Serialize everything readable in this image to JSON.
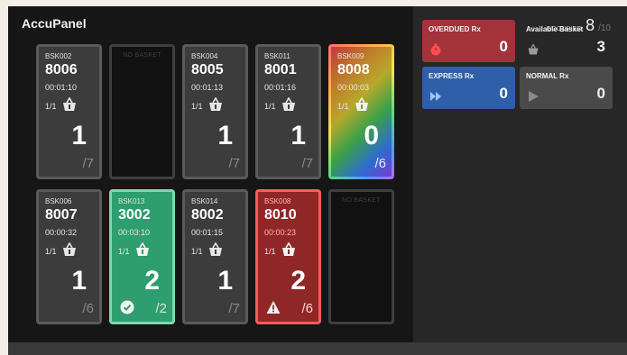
{
  "app": {
    "title": "AccuPanel"
  },
  "occupied": {
    "label": "OCCUPIED",
    "count": "8",
    "total": "/10"
  },
  "cards": [
    {
      "id": "BSK002",
      "code": "8006",
      "time": "00:01:10",
      "frac": "1/1",
      "count": "1",
      "capacity": "/7",
      "state": "normal"
    },
    {
      "empty_label": "NO BASKET",
      "state": "empty"
    },
    {
      "id": "BSK004",
      "code": "8005",
      "time": "00:01:13",
      "frac": "1/1",
      "count": "1",
      "capacity": "/7",
      "state": "normal"
    },
    {
      "id": "BSK011",
      "code": "8001",
      "time": "00:01:16",
      "frac": "1/1",
      "count": "1",
      "capacity": "/7",
      "state": "normal"
    },
    {
      "id": "BSK009",
      "code": "8008",
      "time": "00:00:03",
      "frac": "1/1",
      "count": "0",
      "capacity": "/6",
      "state": "rainbow"
    },
    {
      "id": "BSK006",
      "code": "8007",
      "time": "00:00:32",
      "frac": "1/1",
      "count": "1",
      "capacity": "/6",
      "state": "normal"
    },
    {
      "id": "BSK013",
      "code": "3002",
      "time": "00:03:10",
      "frac": "1/1",
      "count": "2",
      "capacity": "/2",
      "state": "complete"
    },
    {
      "id": "BSK014",
      "code": "8002",
      "time": "00:01:15",
      "frac": "1/1",
      "count": "1",
      "capacity": "/7",
      "state": "normal"
    },
    {
      "id": "BSK008",
      "code": "8010",
      "time": "00:00:23",
      "frac": "1/1",
      "count": "2",
      "capacity": "/6",
      "state": "alert"
    },
    {
      "empty_label": "NO BASKET",
      "state": "empty"
    }
  ],
  "stats": {
    "overdue": {
      "title": "OVERDUED Rx",
      "value": "0",
      "icon": "timer-icon"
    },
    "available": {
      "title": "Available Basket",
      "value": "3",
      "icon": "basket-icon"
    },
    "express": {
      "title": "EXPRESS Rx",
      "value": "0",
      "icon": "fast-forward-icon"
    },
    "normal": {
      "title": "NORMAL Rx",
      "value": "0",
      "icon": "play-icon"
    }
  },
  "colors": {
    "overdue": "#a4323a",
    "express": "#2f5fa8",
    "normal": "#4a4a4a",
    "complete": "#2e9e6e",
    "alert": "#8f2727"
  }
}
